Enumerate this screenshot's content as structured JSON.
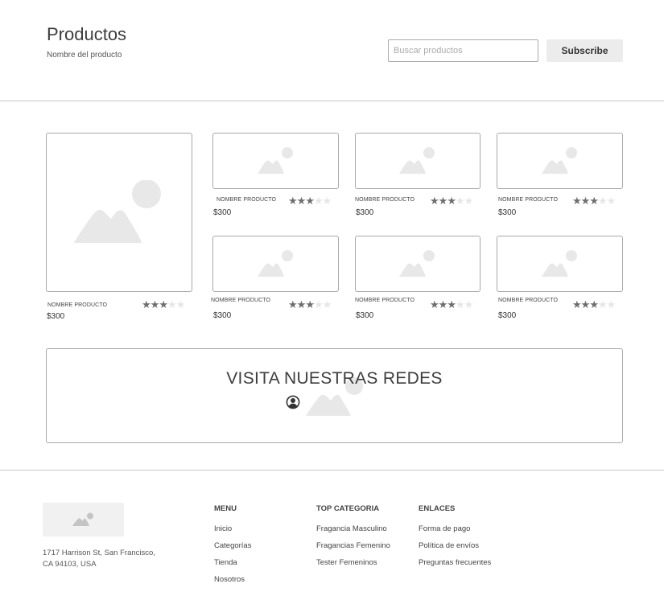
{
  "header": {
    "title": "Productos",
    "subtitle": "Nombre del producto",
    "search_placeholder": "Buscar productos",
    "subscribe_label": "Subscribe"
  },
  "products": [
    {
      "name": "NOMBRE PRODUCTO",
      "price": "$300",
      "rating": 3,
      "max_rating": 5
    },
    {
      "name": "NOMBRE PRODUCTO",
      "price": "$300",
      "rating": 3,
      "max_rating": 5
    },
    {
      "name": "NOMBRE PRODUCTO",
      "price": "$300",
      "rating": 3,
      "max_rating": 5
    },
    {
      "name": "NOMBRE PRODUCTO",
      "price": "$300",
      "rating": 3,
      "max_rating": 5
    },
    {
      "name": "NOMBRE PRODUCTO",
      "price": "$300",
      "rating": 3,
      "max_rating": 5
    },
    {
      "name": "NOMBRE PRODUCTO",
      "price": "$300",
      "rating": 3,
      "max_rating": 5
    },
    {
      "name": "NOMBRE PRODUCTO",
      "price": "$300",
      "rating": 3,
      "max_rating": 5
    }
  ],
  "social": {
    "title": "VISITA NUESTRAS REDES",
    "icon": "user-circle-icon"
  },
  "footer": {
    "address_line1": "1717 Harrison St, San Francisco,",
    "address_line2": "CA 94103, USA",
    "menu": {
      "heading": "MENU",
      "links": [
        "Inicio",
        "Categorías",
        "Tienda",
        "Nosotros"
      ]
    },
    "categories": {
      "heading": "TOP CATEGORIA",
      "links": [
        "Fragancia Masculino",
        "Fragancias Femenino",
        "Tester Femeninos"
      ]
    },
    "links": {
      "heading": "ENLACES",
      "links": [
        "Forma de pago",
        "Política de envíos",
        "Preguntas frecuentes"
      ]
    }
  },
  "colors": {
    "border": "#a8a8a8",
    "placeholder_fill": "#e8e8e8",
    "star_on": "#6e6e6e",
    "star_off": "#e6e6e6"
  }
}
